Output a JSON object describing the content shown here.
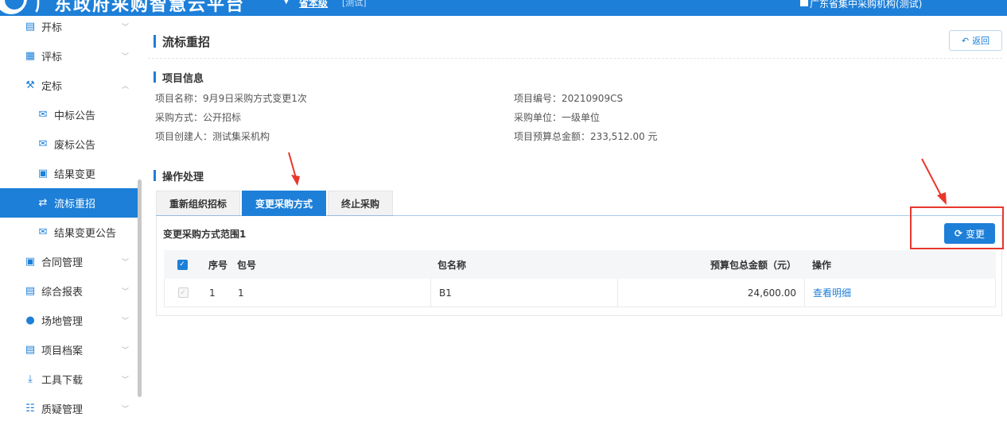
{
  "header": {
    "app_title": "广东政府采购智慧云平台",
    "nav_link": "省本级",
    "nav_tag": "[测试]",
    "user_org": "广东省集中采购机构(测试)"
  },
  "sidebar": {
    "items": [
      {
        "label": "开标",
        "icon": "monitor-icon"
      },
      {
        "label": "评标",
        "icon": "evaluate-icon"
      },
      {
        "label": "定标",
        "icon": "gavel-icon"
      },
      {
        "label": "中标公告",
        "icon": "mail-icon"
      },
      {
        "label": "废标公告",
        "icon": "mail-icon"
      },
      {
        "label": "结果变更",
        "icon": "lock-icon"
      },
      {
        "label": "流标重招",
        "icon": "shuffle-icon"
      },
      {
        "label": "结果变更公告",
        "icon": "mail-icon"
      },
      {
        "label": "合同管理",
        "icon": "lock-icon"
      },
      {
        "label": "综合报表",
        "icon": "report-icon"
      },
      {
        "label": "场地管理",
        "icon": "user-gear-icon"
      },
      {
        "label": "项目档案",
        "icon": "archive-icon"
      },
      {
        "label": "工具下载",
        "icon": "download-icon"
      },
      {
        "label": "质疑管理",
        "icon": "cart-icon"
      }
    ]
  },
  "page": {
    "title": "流标重招",
    "back_label": "返回"
  },
  "project_info": {
    "section_title": "项目信息",
    "name": "项目名称：9月9日采购方式变更1次",
    "code": "项目编号：20210909CS",
    "method": "采购方式：公开招标",
    "unit": "采购单位：一级单位",
    "creator": "项目创建人：测试集采机构",
    "budget": "项目预算总金额：233,512.00 元"
  },
  "operation": {
    "section_title": "操作处理",
    "tabs": [
      {
        "label": "重新组织招标"
      },
      {
        "label": "变更采购方式"
      },
      {
        "label": "终止采购"
      }
    ],
    "range_title": "变更采购方式范围1",
    "change_label": "变更"
  },
  "table": {
    "headers": {
      "seq": "序号",
      "pkg": "包号",
      "name": "包名称",
      "amount": "预算包总金额（元）",
      "op": "操作"
    },
    "rows": [
      {
        "seq": "1",
        "pkg": "1",
        "name": "B1",
        "amount": "24,600.00",
        "op": "查看明细"
      }
    ]
  },
  "colors": {
    "accent": "#1d7fd8",
    "annotation": "#e8382e"
  }
}
